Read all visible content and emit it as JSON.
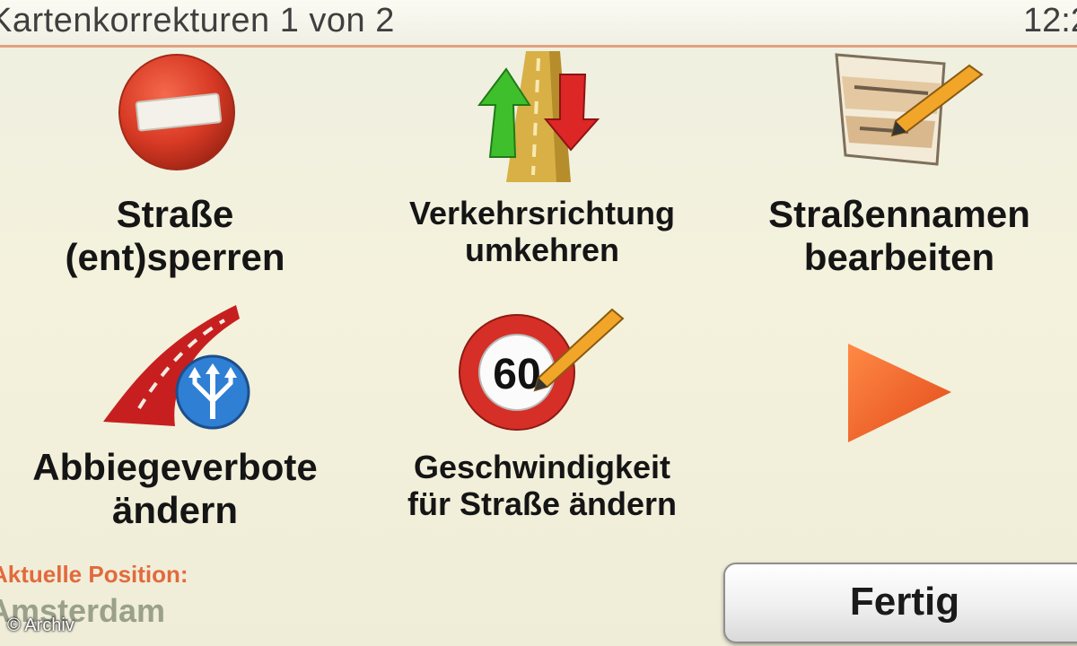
{
  "header": {
    "title": "Kartenkorrekturen 1 von 2",
    "clock": "12:2"
  },
  "menu": {
    "items": [
      {
        "id": "road-block",
        "line1": "Straße",
        "line2": "(ent)sperren",
        "icon": "no-entry-icon"
      },
      {
        "id": "reverse-direction",
        "line1": "Verkehrsrichtung",
        "line2": "umkehren",
        "icon": "traffic-direction-arrows-icon"
      },
      {
        "id": "edit-street-names",
        "line1": "Straßennamen",
        "line2": "bearbeiten",
        "icon": "street-sign-pencil-icon"
      },
      {
        "id": "turn-restrictions",
        "line1": "Abbiegeverbote",
        "line2": "ändern",
        "icon": "road-turn-sign-icon"
      },
      {
        "id": "speed-limit",
        "line1": "Geschwindigkeit",
        "line2": "für Straße ändern",
        "icon": "speed-limit-pencil-icon",
        "speed_value": "60"
      }
    ],
    "next_icon": "next-page-arrow-icon"
  },
  "status": {
    "position_label": "Aktuelle Position:",
    "position_value": "Amsterdam",
    "copyright": "© Archiv"
  },
  "footer": {
    "done_label": "Fertig"
  },
  "colors": {
    "accent_orange": "#e26a3e",
    "title_border": "#e0a27f",
    "no_entry_red": "#d83a25",
    "arrow_green": "#3fbf2c",
    "arrow_red": "#dd2626"
  }
}
